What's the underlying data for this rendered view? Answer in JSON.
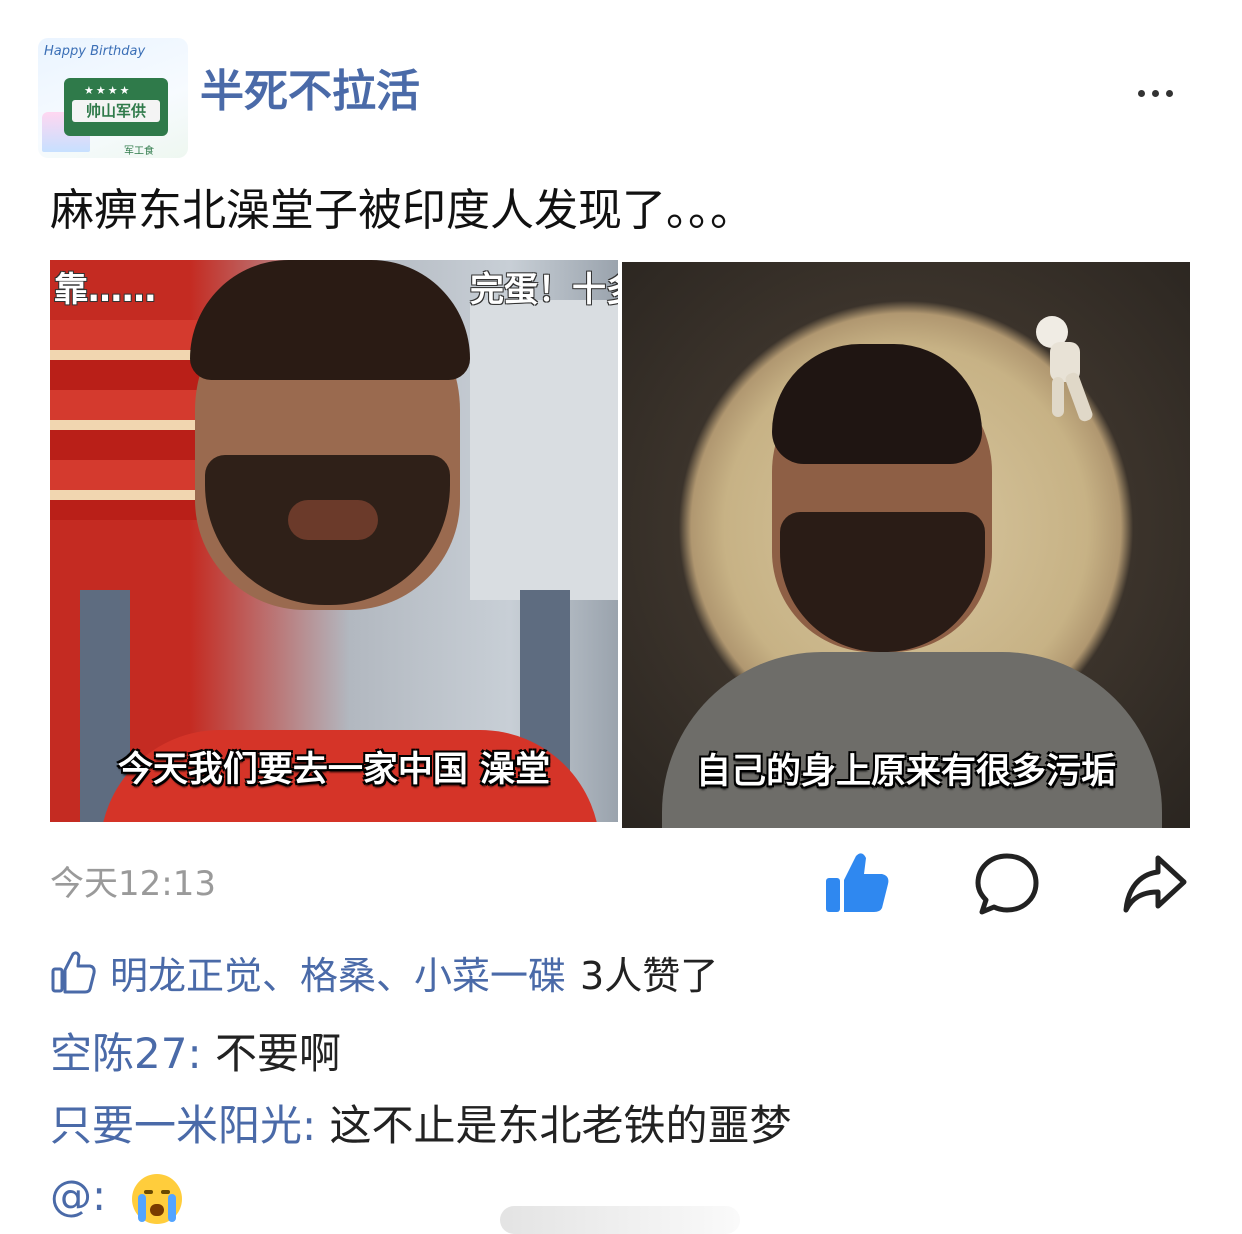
{
  "user": {
    "name": "半死不拉活",
    "avatar_badge": "帅山军供",
    "avatar_arc": "Happy Birthday",
    "avatar_sub": "军工食"
  },
  "post": {
    "text": "麻痹东北澡堂子被印度人发现了。。。",
    "images": [
      {
        "top_left_text": "靠……",
        "top_right_text": "完蛋！十多倍",
        "caption": "今天我们要去一家中国 澡堂"
      },
      {
        "caption": "自己的身上原来有很多污垢"
      }
    ],
    "timestamp": "今天12:13"
  },
  "likes": {
    "names": "明龙正觉、格桑、小菜一碟",
    "count_text": "3人赞了"
  },
  "comments": [
    {
      "author": "空陈27:",
      "text": "不要啊"
    },
    {
      "author": "只要一米阳光:",
      "text": "这不止是东北老铁的噩梦"
    },
    {
      "author": "@:",
      "text": ""
    }
  ],
  "colors": {
    "link": "#4a6aa8",
    "like_active": "#2f88f0",
    "timestamp": "#9a9a9a"
  },
  "icons": [
    "more-icon",
    "thumbs-up-filled-icon",
    "comment-bubble-icon",
    "share-arrow-icon",
    "thumbs-up-outline-icon",
    "crying-face-emoji"
  ]
}
